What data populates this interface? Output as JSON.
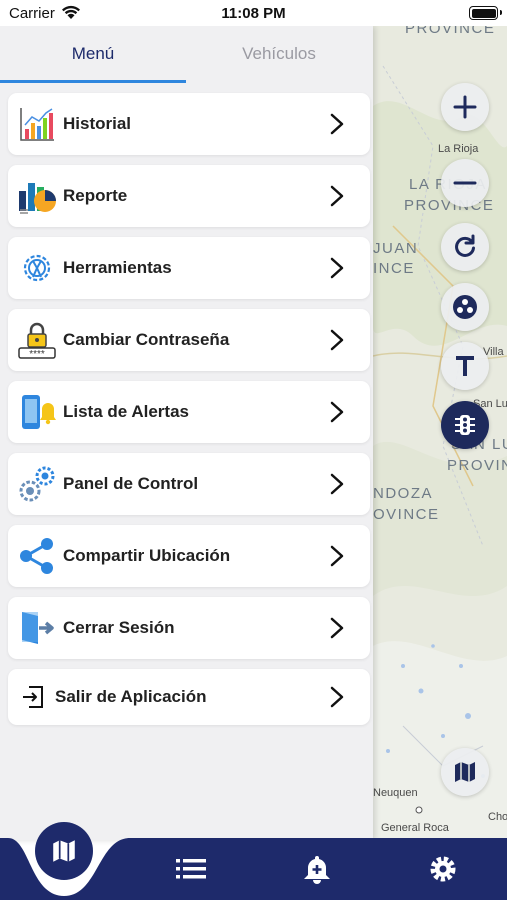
{
  "status_bar": {
    "carrier": "Carrier",
    "time": "11:08 PM"
  },
  "tabs": {
    "menu": "Menú",
    "vehicles": "Vehículos"
  },
  "menu_items": [
    {
      "label": "Historial",
      "icon": "history-chart-icon"
    },
    {
      "label": "Reporte",
      "icon": "report-icon"
    },
    {
      "label": "Herramientas",
      "icon": "tools-gear-icon"
    },
    {
      "label": "Cambiar Contraseña",
      "icon": "password-lock-icon"
    },
    {
      "label": "Lista de Alertas",
      "icon": "alerts-list-icon"
    },
    {
      "label": "Panel de Control",
      "icon": "control-panel-gears-icon"
    },
    {
      "label": "Compartir Ubicación",
      "icon": "share-icon"
    },
    {
      "label": "Cerrar Sesión",
      "icon": "logout-door-icon"
    },
    {
      "label": "Salir de Aplicación",
      "icon": "exit-app-icon"
    }
  ],
  "map": {
    "labels": [
      "PROVINCE",
      "La Rioja",
      "LA RIOJA",
      "PROVINCE",
      "JUAN",
      "INCE",
      "Villa",
      "San Luis",
      "SAN LUIS",
      "PROVINCE",
      "NDOZA",
      "OVINCE",
      "Neuquen",
      "General Roca",
      "Cho"
    ],
    "controls": [
      "zoom-in",
      "zoom-out",
      "refresh",
      "map-layers",
      "traffic-text",
      "traffic-light",
      "map-type"
    ]
  },
  "bottom_nav": [
    "map-icon",
    "list-icon",
    "alert-bell-icon",
    "settings-gear-icon"
  ],
  "colors": {
    "brand": "#1e2a6b",
    "tab_active": "#1d2a6b",
    "tab_inactive": "#9a9aa2",
    "indicator": "#2e86de",
    "drawer_bg": "#f0f0f2"
  }
}
